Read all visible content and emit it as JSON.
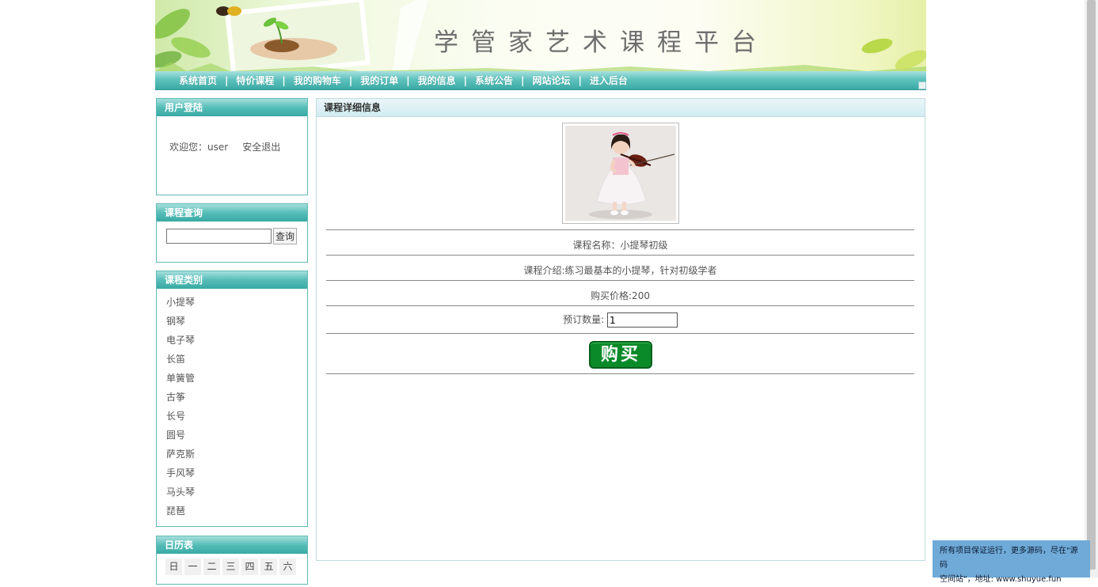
{
  "banner": {
    "title": "学管家艺术课程平台"
  },
  "nav": {
    "items": [
      "系统首页",
      "特价课程",
      "我的购物车",
      "我的订单",
      "我的信息",
      "系统公告",
      "网站论坛",
      "进入后台"
    ],
    "separator": "|"
  },
  "login": {
    "title": "用户登陆",
    "welcome": "欢迎您：user",
    "logout": "安全退出"
  },
  "search": {
    "title": "课程查询",
    "value": "",
    "button": "查询"
  },
  "categories": {
    "title": "课程类别",
    "items": [
      "小提琴",
      "钢琴",
      "电子琴",
      "长笛",
      "单簧管",
      "古筝",
      "长号",
      "圆号",
      "萨克斯",
      "手风琴",
      "马头琴",
      "琵琶"
    ]
  },
  "calendar": {
    "title": "日历表",
    "weekdays": [
      "日",
      "一",
      "二",
      "三",
      "四",
      "五",
      "六"
    ]
  },
  "detail": {
    "title": "课程详细信息",
    "image_alt": "girl-playing-violin",
    "name_row": "课程名称：小提琴初级",
    "intro_row": "课程介绍:练习最基本的小提琴，针对初级学者",
    "price_row": "购买价格:200",
    "qty_label": "预订数量:",
    "qty_value": "1",
    "buy_label": "购买"
  },
  "notice": {
    "line1": "所有项目保证运行，更多源码，尽在\"源码",
    "line2": "空间站\"，地址: www.shuyue.fun"
  },
  "colors": {
    "accent": "#39a9a3",
    "buy": "#0b8a2a",
    "notice": "#6faad8"
  }
}
